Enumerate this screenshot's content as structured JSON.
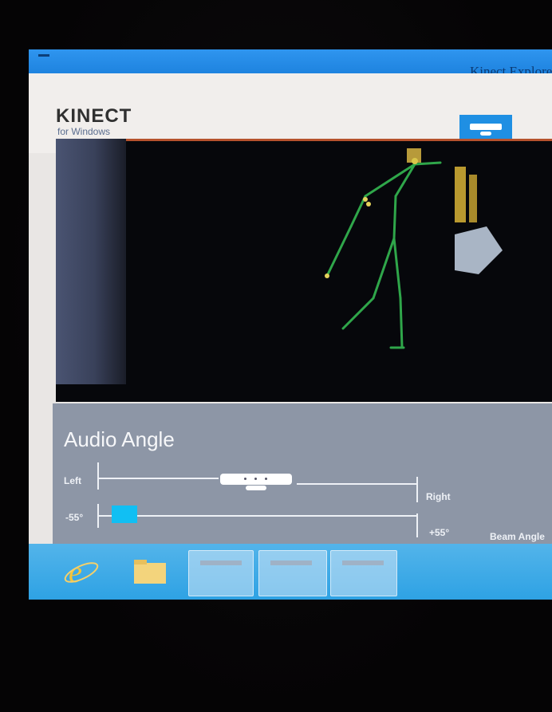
{
  "window": {
    "title": "Kinect Explorer"
  },
  "header": {
    "logo_main": "KINECT",
    "logo_sub": "for Windows",
    "sensor_icon": "kinect-sensor-icon"
  },
  "viewer": {
    "content": "skeleton-tracking-view"
  },
  "audio": {
    "title": "Audio Angle",
    "sound_source": {
      "left_label": "Left",
      "right_label": "Right"
    },
    "beam": {
      "min_label": "-55°",
      "max_label": "+55°",
      "name_label": "Beam Angle"
    }
  },
  "taskbar": {
    "items": [
      {
        "icon": "internet-explorer-icon"
      },
      {
        "icon": "file-explorer-icon"
      },
      {
        "icon": "window-thumbnail-icon"
      },
      {
        "icon": "window-thumbnail-icon"
      },
      {
        "icon": "window-thumbnail-icon"
      }
    ]
  },
  "colors": {
    "accent": "#1f8fe3",
    "beam_marker": "#11bff3",
    "panel": "#8d96a6",
    "skeleton": "#2fa64a"
  }
}
